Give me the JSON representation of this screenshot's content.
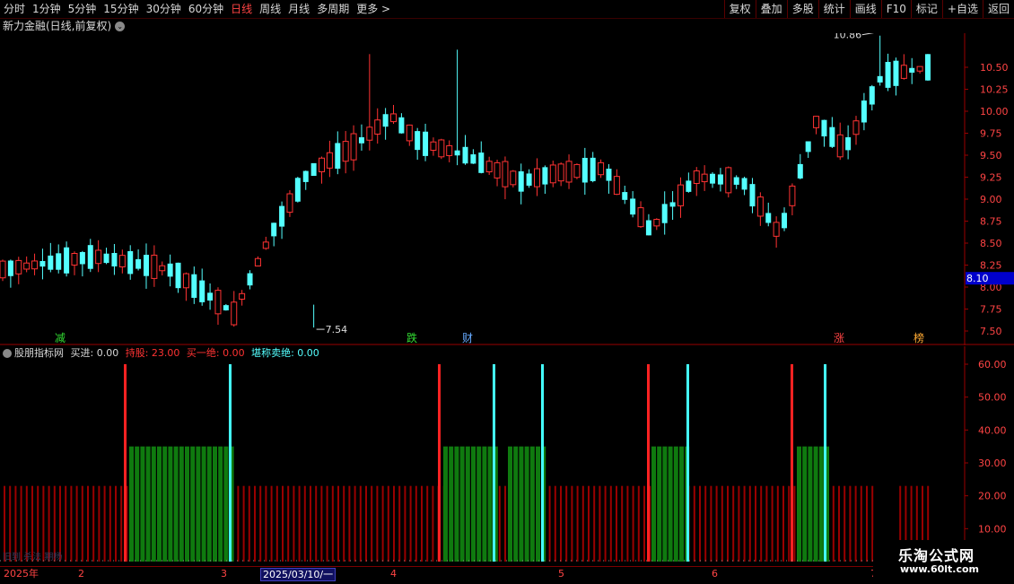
{
  "toolbar": {
    "tabs": [
      "分时",
      "1分钟",
      "5分钟",
      "15分钟",
      "30分钟",
      "60分钟",
      "日线",
      "周线",
      "月线",
      "多周期",
      "更多 >"
    ],
    "active_tab": "日线",
    "tools": [
      "复权",
      "叠加",
      "多股",
      "统计",
      "画线",
      "F10",
      "标记",
      "+自选",
      "返回"
    ]
  },
  "stock_title": "新力金融(日线,前复权)",
  "indicator": {
    "name": "股朋指标网",
    "buy_label": "买进: 0.00",
    "hold_label": "持股: 23.00",
    "buy_one_label": "买一绝: 0.00",
    "sell_label": "堪称卖绝: 0.00"
  },
  "price_axis": {
    "ticks": [
      "10.50",
      "10.25",
      "10.00",
      "9.75",
      "9.50",
      "9.25",
      "9.00",
      "8.75",
      "8.50",
      "8.25",
      "8.00",
      "7.75",
      "7.50"
    ],
    "current_price": "8.10",
    "max_label": "10.86",
    "min_label": "7.54"
  },
  "indicator_axis": {
    "ticks": [
      "60.00",
      "50.00",
      "40.00",
      "30.00",
      "20.00",
      "10.00"
    ]
  },
  "event_markers": [
    {
      "text": "减",
      "color": "#33dd33"
    },
    {
      "text": "跌",
      "color": "#33dd33"
    },
    {
      "text": "财",
      "color": "#66aaff"
    },
    {
      "text": "涨",
      "color": "#ff4444"
    },
    {
      "text": "榜",
      "color": "#ffaa33"
    }
  ],
  "dates": {
    "year": "2025年",
    "months": [
      "2",
      "3",
      "4",
      "5",
      "6",
      "7"
    ],
    "highlight": "2025/03/10/一"
  },
  "faint_text": "旧到 杀法 期杨",
  "watermark": {
    "line1": "乐淘公式网",
    "line2": "www.60lt.com"
  },
  "colors": {
    "up": "#ff3333",
    "down": "#54ffff",
    "green": "#0f7a0f",
    "hold": "#9a0000"
  }
}
